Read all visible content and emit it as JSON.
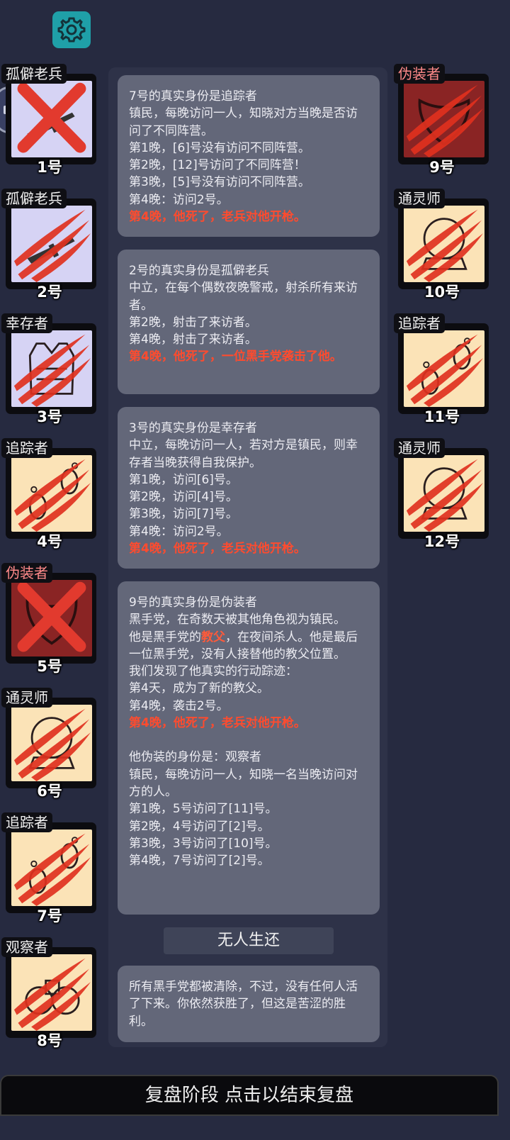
{
  "players": [
    {
      "role": "孤僻老兵",
      "number": "1号",
      "status": "cross",
      "bg": "neutral",
      "side": "left",
      "portrait": "gun-icon"
    },
    {
      "role": "孤僻老兵",
      "number": "2号",
      "status": "claw",
      "bg": "neutral",
      "side": "left",
      "portrait": "gun-icon"
    },
    {
      "role": "幸存者",
      "number": "3号",
      "status": "claw",
      "bg": "neutral",
      "side": "left",
      "portrait": "vest-icon"
    },
    {
      "role": "追踪者",
      "number": "4号",
      "status": "claw",
      "bg": "townie",
      "side": "left",
      "portrait": "footprint-icon"
    },
    {
      "role": "伪装者",
      "number": "5号",
      "status": "cross",
      "bg": "mafia",
      "side": "left",
      "portrait": "mask-icon",
      "role_red": true
    },
    {
      "role": "通灵师",
      "number": "6号",
      "status": "claw",
      "bg": "townie",
      "side": "left",
      "portrait": "crystal-ball-icon"
    },
    {
      "role": "追踪者",
      "number": "7号",
      "status": "claw",
      "bg": "townie",
      "side": "left",
      "portrait": "footprint-icon"
    },
    {
      "role": "观察者",
      "number": "8号",
      "status": "claw",
      "bg": "townie",
      "side": "left",
      "portrait": "binoculars-icon"
    },
    {
      "role": "伪装者",
      "number": "9号",
      "status": "claw",
      "bg": "mafia",
      "side": "right",
      "portrait": "mask-icon",
      "role_red": true
    },
    {
      "role": "通灵师",
      "number": "10号",
      "status": "claw",
      "bg": "townie",
      "side": "right",
      "portrait": "crystal-ball-icon"
    },
    {
      "role": "追踪者",
      "number": "11号",
      "status": "claw",
      "bg": "townie",
      "side": "right",
      "portrait": "footprint-icon"
    },
    {
      "role": "通灵师",
      "number": "12号",
      "status": "claw",
      "bg": "townie",
      "side": "right",
      "portrait": "crystal-ball-icon"
    }
  ],
  "messages": [
    {
      "lines": [
        {
          "t": "7号的真实身份是追踪者"
        },
        {
          "t": "镇民，每晚访问一人，知晓对方当晚是否访问了不同阵营。"
        },
        {
          "t": "第1晚，[6]号没有访问不同阵营。"
        },
        {
          "t": "第2晚，[12]号访问了不同阵营！"
        },
        {
          "t": "第3晚，[5]号没有访问不同阵营。"
        },
        {
          "t": "第4晚：访问2号。"
        },
        {
          "t": "第4晚，他死了，老兵对他开枪。",
          "death": true
        }
      ]
    },
    {
      "lines": [
        {
          "t": "2号的真实身份是孤僻老兵"
        },
        {
          "t": "中立，在每个偶数夜晚警戒，射杀所有来访者。"
        },
        {
          "t": "第2晚，射击了来访者。"
        },
        {
          "t": "第4晚，射击了来访者。"
        },
        {
          "t": "第4晚，他死了，一位黑手党袭击了他。",
          "death": true
        }
      ]
    },
    {
      "lines": [
        {
          "t": "3号的真实身份是幸存者"
        },
        {
          "t": "中立，每晚访问一人，若对方是镇民，则幸存者当晚获得自我保护。"
        },
        {
          "t": "第1晚，访问[6]号。"
        },
        {
          "t": "第2晚，访问[4]号。"
        },
        {
          "t": "第3晚，访问[7]号。"
        },
        {
          "t": "第4晚：访问2号。"
        },
        {
          "t": "第4晚，他死了，老兵对他开枪。",
          "death": true
        }
      ]
    },
    {
      "lines": [
        {
          "t": "9号的真实身份是伪装者"
        },
        {
          "t": "黑手党，在奇数天被其他角色视为镇民。"
        },
        {
          "t": "他是黑手党的",
          "hl": "教父",
          "t2": "，在夜间杀人。他是最后一位黑手党，没有人接替他的教父位置。"
        },
        {
          "t": "我们发现了他真实的行动踪迹："
        },
        {
          "t": "第4天，成为了新的教父。"
        },
        {
          "t": "第4晚，袭击2号。"
        },
        {
          "t": "第4晚，他死了，老兵对他开枪。",
          "death": true
        },
        {
          "t": "",
          "blank": true
        },
        {
          "t": "他伪装的身份是：观察者"
        },
        {
          "t": "镇民，每晚访问一人，知晓一名当晚访问对方的人。"
        },
        {
          "t": "第1晚，5号访问了[11]号。"
        },
        {
          "t": "第2晚，4号访问了[2]号。"
        },
        {
          "t": "第3晚，3号访问了[10]号。"
        },
        {
          "t": "第4晚，7号访问了[2]号。"
        }
      ]
    }
  ],
  "outcome_banner": "无人生还",
  "outcome_message": "所有黑手党都被清除，不过，没有任何人活了下来。你依然获胜了，但这是苦涩的胜利。",
  "footer_label": "复盘阶段 点击以结束复盘",
  "colors": {
    "claw": "#e0311f",
    "cross": "#e23a2e",
    "death_text": "#ff4b2e",
    "settings_button": "#1fa0a8"
  }
}
